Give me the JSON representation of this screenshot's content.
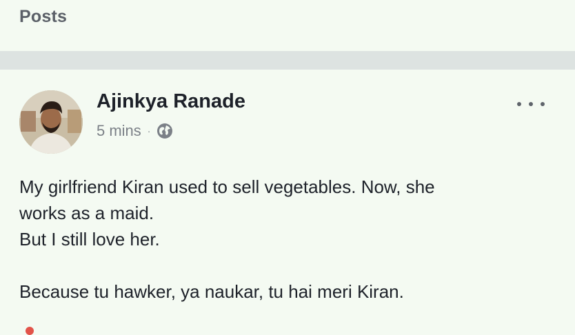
{
  "header": {
    "title": "Posts"
  },
  "post": {
    "author_name": "Ajinkya Ranade",
    "timestamp": "5 mins",
    "separator": "·",
    "privacy_icon": "globe-icon",
    "more_icon": "more-options-icon",
    "lines": [
      "My girlfriend Kiran used to sell vegetables. Now, she",
      "works as a maid.",
      "But I still love her."
    ],
    "last_line": "Because tu hawker, ya naukar, tu hai meri Kiran."
  },
  "colors": {
    "background": "#f4faf2",
    "divider": "#dde3e1",
    "header_text": "#5b6068",
    "primary_text": "#1d2129",
    "secondary_text": "#7b8087"
  }
}
